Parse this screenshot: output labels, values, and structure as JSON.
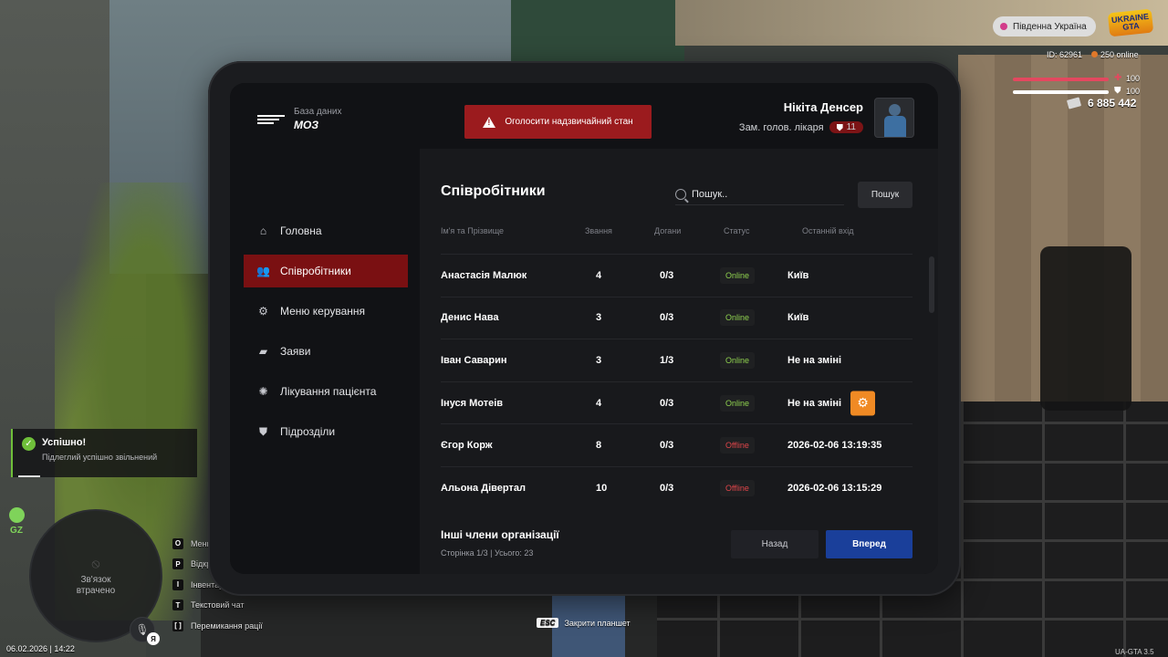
{
  "hud": {
    "server_name": "Південна Україна",
    "game_logo": "UKRAINE GTA",
    "player_id": "ID: 62961",
    "online": "250 online",
    "health_value": "100",
    "health_percent": 100,
    "armor_value": "100",
    "armor_percent": 100,
    "money": "6 885 442",
    "notification_title": "Успішно!",
    "notification_text": "Підлеглий успішно звільнений",
    "zone_tag": "GZ",
    "minimap_status": "Зв'язок втрачено",
    "mic_badge": "Я",
    "datetime": "06.02.2026 | 14:22",
    "keybinds": [
      {
        "key": "O",
        "label": "Меню"
      },
      {
        "key": "P",
        "label": "Відкрити"
      },
      {
        "key": "I",
        "label": "Інвентар"
      },
      {
        "key": "T",
        "label": "Текстовий чат"
      },
      {
        "key": "[ ]",
        "label": "Перемикання рації"
      }
    ],
    "esc_key": "ESC",
    "esc_label": "Закрити планшет",
    "version": "UA-GTA 3.5"
  },
  "tablet": {
    "logo": {
      "subtitle": "База даних",
      "title": "МОЗ"
    },
    "emergency_button": "Оголосити надзвичайний стан",
    "user": {
      "name": "Нікіта Денсер",
      "role": "Зам. голов. лікаря",
      "rank": "11"
    },
    "nav": [
      {
        "label": "Головна",
        "icon": "home-icon",
        "active": false
      },
      {
        "label": "Співробітники",
        "icon": "users-icon",
        "active": true
      },
      {
        "label": "Меню керування",
        "icon": "gear-icon",
        "active": false
      },
      {
        "label": "Заяви",
        "icon": "folder-icon",
        "active": false
      },
      {
        "label": "Лікування пацієнта",
        "icon": "virus-icon",
        "active": false
      },
      {
        "label": "Підрозділи",
        "icon": "shield-icon",
        "active": false
      }
    ],
    "page_title": "Співробітники",
    "search": {
      "placeholder": "Пошук..",
      "button": "Пошук"
    },
    "table": {
      "headers": [
        "Ім'я та Прізвище",
        "Звання",
        "Догани",
        "Статус",
        "Останній вхід"
      ],
      "rows": [
        {
          "name": "Анастасія Малюк",
          "rank": "4",
          "reprimands": "0/3",
          "status": "Online",
          "last": "Київ",
          "gear": false
        },
        {
          "name": "Денис Нава",
          "rank": "3",
          "reprimands": "0/3",
          "status": "Online",
          "last": "Київ",
          "gear": false
        },
        {
          "name": "Іван Саварин",
          "rank": "3",
          "reprimands": "1/3",
          "status": "Online",
          "last": "Не на зміні",
          "gear": false
        },
        {
          "name": "Інуся Мотеів",
          "rank": "4",
          "reprimands": "0/3",
          "status": "Online",
          "last": "Не на зміні",
          "gear": true
        },
        {
          "name": "Єгор Корж",
          "rank": "8",
          "reprimands": "0/3",
          "status": "Offline",
          "last": "2026-02-06 13:19:35",
          "gear": false
        },
        {
          "name": "Альона Дівертал",
          "rank": "10",
          "reprimands": "0/3",
          "status": "Offline",
          "last": "2026-02-06 13:15:29",
          "gear": false
        }
      ]
    },
    "footer": {
      "title": "Інші члени організації",
      "page_info": "Сторінка 1/3 | Усього: 23",
      "back": "Назад",
      "next": "Вперед"
    }
  },
  "colors": {
    "accent_red": "#7a1012",
    "emergency_red": "#9b1b1e",
    "next_blue": "#1a3f9a",
    "online_green": "#8fd14f",
    "offline_red": "#e0454a",
    "gear_orange": "#f08a24"
  }
}
